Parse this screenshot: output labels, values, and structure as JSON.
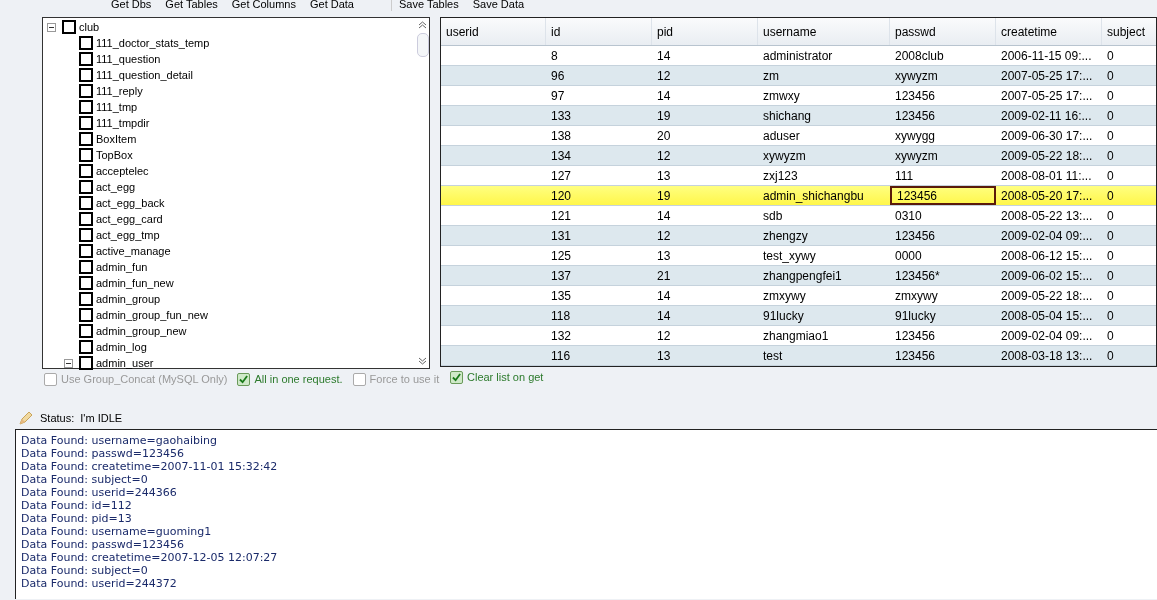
{
  "toolbar": {
    "buttons": [
      "Get Dbs",
      "Get Tables",
      "Get Columns",
      "Get Data",
      "Save Tables",
      "Save Data"
    ]
  },
  "tree": {
    "label": "club",
    "checked": false,
    "expanded": true,
    "children": [
      {
        "label": "111_doctor_stats_temp",
        "checked": false
      },
      {
        "label": "111_question",
        "checked": false
      },
      {
        "label": "111_question_detail",
        "checked": false
      },
      {
        "label": "111_reply",
        "checked": false
      },
      {
        "label": "111_tmp",
        "checked": false
      },
      {
        "label": "111_tmpdir",
        "checked": false
      },
      {
        "label": "BoxItem",
        "checked": false
      },
      {
        "label": "TopBox",
        "checked": false
      },
      {
        "label": "acceptelec",
        "checked": false
      },
      {
        "label": "act_egg",
        "checked": false
      },
      {
        "label": "act_egg_back",
        "checked": false
      },
      {
        "label": "act_egg_card",
        "checked": false
      },
      {
        "label": "act_egg_tmp",
        "checked": false
      },
      {
        "label": "active_manage",
        "checked": false
      },
      {
        "label": "admin_fun",
        "checked": false
      },
      {
        "label": "admin_fun_new",
        "checked": false
      },
      {
        "label": "admin_group",
        "checked": false
      },
      {
        "label": "admin_group_fun_new",
        "checked": false
      },
      {
        "label": "admin_group_new",
        "checked": false
      },
      {
        "label": "admin_log",
        "checked": false
      },
      {
        "label": "admin_user",
        "checked": false,
        "expanded": true
      }
    ]
  },
  "left_options": [
    {
      "label": "Use Group_Concat (MySQL Only)",
      "checked": false,
      "disabled": true
    },
    {
      "label": "All in one request.",
      "checked": true,
      "disabled": false
    },
    {
      "label": "Force to use it",
      "checked": false,
      "disabled": true
    }
  ],
  "grid": {
    "columns": [
      "userid",
      "id",
      "pid",
      "username",
      "passwd",
      "createtime",
      "subject"
    ],
    "rows": [
      {
        "selected": false,
        "cells": [
          {
            "text": "",
            "focused": false
          },
          {
            "text": "8",
            "focused": false
          },
          {
            "text": "14",
            "focused": false
          },
          {
            "text": "administrator",
            "focused": false
          },
          {
            "text": "2008club",
            "focused": false
          },
          {
            "text": "2006-11-15 09:...",
            "focused": false
          },
          {
            "text": "0",
            "focused": false
          }
        ]
      },
      {
        "selected": false,
        "cells": [
          {
            "text": "",
            "focused": false
          },
          {
            "text": "96",
            "focused": false
          },
          {
            "text": "12",
            "focused": false
          },
          {
            "text": "zm",
            "focused": false
          },
          {
            "text": "xywyzm",
            "focused": false
          },
          {
            "text": "2007-05-25 17:...",
            "focused": false
          },
          {
            "text": "0",
            "focused": false
          }
        ]
      },
      {
        "selected": false,
        "cells": [
          {
            "text": "",
            "focused": false
          },
          {
            "text": "97",
            "focused": false
          },
          {
            "text": "14",
            "focused": false
          },
          {
            "text": "zmwxy",
            "focused": false
          },
          {
            "text": "123456",
            "focused": false
          },
          {
            "text": "2007-05-25 17:...",
            "focused": false
          },
          {
            "text": "0",
            "focused": false
          }
        ]
      },
      {
        "selected": false,
        "cells": [
          {
            "text": "",
            "focused": false
          },
          {
            "text": "133",
            "focused": false
          },
          {
            "text": "19",
            "focused": false
          },
          {
            "text": "shichang",
            "focused": false
          },
          {
            "text": "123456",
            "focused": false
          },
          {
            "text": "2009-02-11 16:...",
            "focused": false
          },
          {
            "text": "0",
            "focused": false
          }
        ]
      },
      {
        "selected": false,
        "cells": [
          {
            "text": "",
            "focused": false
          },
          {
            "text": "138",
            "focused": false
          },
          {
            "text": "20",
            "focused": false
          },
          {
            "text": "aduser",
            "focused": false
          },
          {
            "text": "xywygg",
            "focused": false
          },
          {
            "text": "2009-06-30 17:...",
            "focused": false
          },
          {
            "text": "0",
            "focused": false
          }
        ]
      },
      {
        "selected": false,
        "cells": [
          {
            "text": "",
            "focused": false
          },
          {
            "text": "134",
            "focused": false
          },
          {
            "text": "12",
            "focused": false
          },
          {
            "text": "xywyzm",
            "focused": false
          },
          {
            "text": "xywyzm",
            "focused": false
          },
          {
            "text": "2009-05-22 18:...",
            "focused": false
          },
          {
            "text": "0",
            "focused": false
          }
        ]
      },
      {
        "selected": false,
        "cells": [
          {
            "text": "",
            "focused": false
          },
          {
            "text": "127",
            "focused": false
          },
          {
            "text": "13",
            "focused": false
          },
          {
            "text": "zxj123",
            "focused": false
          },
          {
            "text": "111",
            "focused": false
          },
          {
            "text": "2008-08-01 11:...",
            "focused": false
          },
          {
            "text": "0",
            "focused": false
          }
        ]
      },
      {
        "selected": true,
        "cells": [
          {
            "text": "",
            "focused": false
          },
          {
            "text": "120",
            "focused": false
          },
          {
            "text": "19",
            "focused": false
          },
          {
            "text": "admin_shichangbu",
            "focused": false
          },
          {
            "text": "123456",
            "focused": true
          },
          {
            "text": "2008-05-20 17:...",
            "focused": false
          },
          {
            "text": "0",
            "focused": false
          }
        ]
      },
      {
        "selected": false,
        "cells": [
          {
            "text": "",
            "focused": false
          },
          {
            "text": "121",
            "focused": false
          },
          {
            "text": "14",
            "focused": false
          },
          {
            "text": "sdb",
            "focused": false
          },
          {
            "text": "0310",
            "focused": false
          },
          {
            "text": "2008-05-22 13:...",
            "focused": false
          },
          {
            "text": "0",
            "focused": false
          }
        ]
      },
      {
        "selected": false,
        "cells": [
          {
            "text": "",
            "focused": false
          },
          {
            "text": "131",
            "focused": false
          },
          {
            "text": "12",
            "focused": false
          },
          {
            "text": "zhengzy",
            "focused": false
          },
          {
            "text": "123456",
            "focused": false
          },
          {
            "text": "2009-02-04 09:...",
            "focused": false
          },
          {
            "text": "0",
            "focused": false
          }
        ]
      },
      {
        "selected": false,
        "cells": [
          {
            "text": "",
            "focused": false
          },
          {
            "text": "125",
            "focused": false
          },
          {
            "text": "13",
            "focused": false
          },
          {
            "text": "test_xywy",
            "focused": false
          },
          {
            "text": "0000",
            "focused": false
          },
          {
            "text": "2008-06-12 15:...",
            "focused": false
          },
          {
            "text": "0",
            "focused": false
          }
        ]
      },
      {
        "selected": false,
        "cells": [
          {
            "text": "",
            "focused": false
          },
          {
            "text": "137",
            "focused": false
          },
          {
            "text": "21",
            "focused": false
          },
          {
            "text": "zhangpengfei1",
            "focused": false
          },
          {
            "text": "123456*",
            "focused": false
          },
          {
            "text": "2009-06-02 15:...",
            "focused": false
          },
          {
            "text": "0",
            "focused": false
          }
        ]
      },
      {
        "selected": false,
        "cells": [
          {
            "text": "",
            "focused": false
          },
          {
            "text": "135",
            "focused": false
          },
          {
            "text": "14",
            "focused": false
          },
          {
            "text": "zmxywy",
            "focused": false
          },
          {
            "text": "zmxywy",
            "focused": false
          },
          {
            "text": "2009-05-22 18:...",
            "focused": false
          },
          {
            "text": "0",
            "focused": false
          }
        ]
      },
      {
        "selected": false,
        "cells": [
          {
            "text": "",
            "focused": false
          },
          {
            "text": "118",
            "focused": false
          },
          {
            "text": "14",
            "focused": false
          },
          {
            "text": "91lucky",
            "focused": false
          },
          {
            "text": "91lucky",
            "focused": false
          },
          {
            "text": "2008-05-04 15:...",
            "focused": false
          },
          {
            "text": "0",
            "focused": false
          }
        ]
      },
      {
        "selected": false,
        "cells": [
          {
            "text": "",
            "focused": false
          },
          {
            "text": "132",
            "focused": false
          },
          {
            "text": "12",
            "focused": false
          },
          {
            "text": "zhangmiao1",
            "focused": false
          },
          {
            "text": "123456",
            "focused": false
          },
          {
            "text": "2009-02-04 09:...",
            "focused": false
          },
          {
            "text": "0",
            "focused": false
          }
        ]
      },
      {
        "selected": false,
        "cells": [
          {
            "text": "",
            "focused": false
          },
          {
            "text": "116",
            "focused": false
          },
          {
            "text": "13",
            "focused": false
          },
          {
            "text": "test",
            "focused": false
          },
          {
            "text": "123456",
            "focused": false
          },
          {
            "text": "2008-03-18 13:...",
            "focused": false
          },
          {
            "text": "0",
            "focused": false
          }
        ]
      }
    ]
  },
  "right_options": [
    {
      "label": "Clear list on get",
      "checked": true,
      "disabled": false
    }
  ],
  "status": {
    "label": "Status:",
    "text": "I'm IDLE"
  },
  "log": {
    "lines": [
      "Data Found: username=gaohaibing",
      "Data Found: passwd=123456",
      "Data Found: createtime=2007-11-01 15:32:42",
      "Data Found: subject=0",
      "Data Found: userid=244366",
      "Data Found: id=112",
      "Data Found: pid=13",
      "Data Found: username=guoming1",
      "Data Found: passwd=123456",
      "Data Found: createtime=2007-12-05 12:07:27",
      "Data Found: subject=0",
      "Data Found: userid=244372"
    ]
  }
}
